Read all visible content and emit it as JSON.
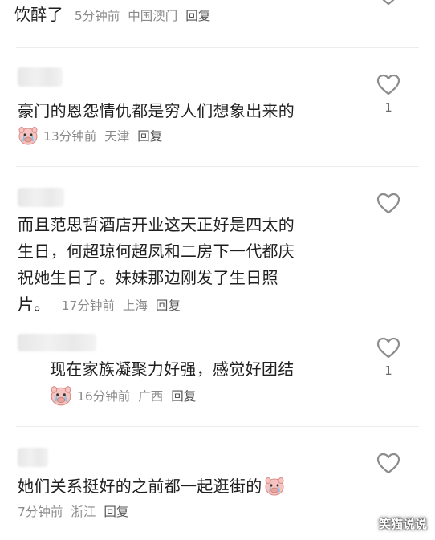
{
  "comments": [
    {
      "text": "饮醉了",
      "time": "5分钟前",
      "location": "中国澳门",
      "reply": "回复"
    },
    {
      "text": "豪门的恩怨情仇都是穷人们想象出来的",
      "time": "13分钟前",
      "location": "天津",
      "reply": "回复",
      "likes": "1"
    },
    {
      "lines": [
        "而且范思哲酒店开业这天正好是四太的",
        "生日，何超琼何超凤和二房下一代都庆",
        "祝她生日了。妹妹那边刚发了生日照",
        "片。"
      ],
      "time": "17分钟前",
      "location": "上海",
      "reply": "回复"
    },
    {
      "text": "现在家族凝聚力好强，感觉好团结",
      "time": "16分钟前",
      "location": "广西",
      "reply": "回复",
      "likes": "1"
    },
    {
      "text": "她们关系挺好的之前都一起逛街的",
      "time": "7分钟前",
      "location": "浙江",
      "reply": "回复"
    }
  ],
  "watermark": "笑猫说说",
  "colors": {
    "text": "#1f1f1f",
    "meta": "#8a8a8a",
    "icon": "#8c8c8c",
    "emoji_face": "#f6c4c0"
  },
  "icons": {
    "like": "heart-outline-icon",
    "emoji": "crying-pig-emoji"
  }
}
